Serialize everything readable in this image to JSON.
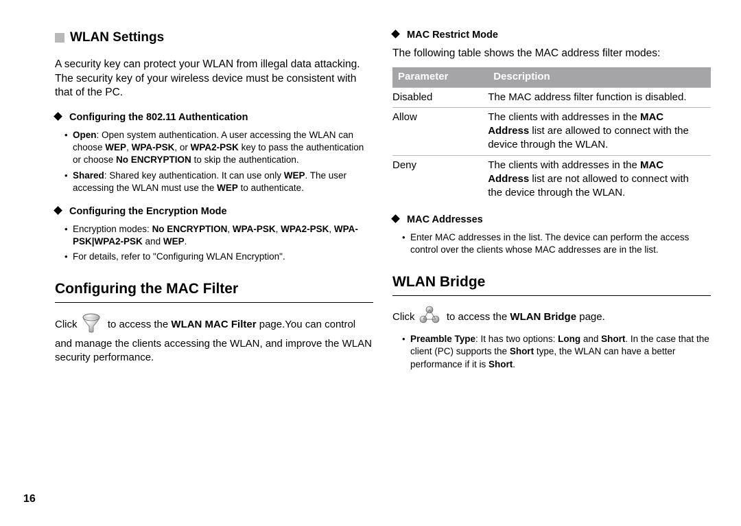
{
  "page_number": "16",
  "title": "WLAN Settings",
  "left": {
    "intro": "A security key can protect your WLAN from illegal data attacking. The security key of your wireless device must be consistent with that of the PC.",
    "s1_title": "Configuring the 802.11 Authentication",
    "s1_bullets": [
      {
        "lead": "Open",
        "rest": ": Open system authentication. A user accessing the WLAN can choose ",
        "b1": "WEP",
        "c1": ", ",
        "b2": "WPA-PSK",
        "c2": ", or ",
        "b3": "WPA2-PSK",
        "rest2": " key to pass the authentication or choose ",
        "b4": "No ENCRYPTION",
        "rest3": " to skip the authentication."
      },
      {
        "lead": "Shared",
        "rest": ": Shared key authentication. It can use only ",
        "b1": "WEP",
        "c1": ". The user accessing the WLAN must use the ",
        "b2": "WEP",
        "rest2": " to authenticate."
      }
    ],
    "s2_title": "Configuring the Encryption Mode",
    "s2_bullets": [
      {
        "pre": "Encryption modes: ",
        "b1": "No ENCRYPTION",
        "c1": ", ",
        "b2": "WPA-PSK",
        "c2": ", ",
        "b3": "WPA2-PSK",
        "c3": ", ",
        "b4": "WPA-PSK|WPA2-PSK",
        "c4": " and ",
        "b5": "WEP",
        "rest": "."
      },
      {
        "pre": "For details, refer to \"Configuring WLAN Encryption\"."
      }
    ],
    "h2": "Configuring the MAC Filter",
    "mac_intro_pre": "Click ",
    "mac_intro_mid": " to access the ",
    "mac_intro_bold": "WLAN MAC Filter",
    "mac_intro_post": " page.You can control and manage the clients accessing the WLAN, and improve the WLAN security performance."
  },
  "right": {
    "s1_title": "MAC Restrict Mode",
    "s1_intro": "The following table shows the MAC address filter modes:",
    "table": {
      "headers": {
        "p": "Parameter",
        "d": "Description"
      },
      "rows": [
        {
          "p": "Disabled",
          "d_pre": "The MAC address filter function is disabled."
        },
        {
          "p": "Allow",
          "d_pre": "The clients with addresses in the ",
          "d_b": "MAC Address",
          "d_post": " list are allowed to connect with the device through the WLAN."
        },
        {
          "p": "Deny",
          "d_pre": "The clients with addresses in the ",
          "d_b": "MAC Address",
          "d_post": " list are not allowed to connect with the device through the WLAN."
        }
      ]
    },
    "s2_title": "MAC Addresses",
    "s2_bullet": "Enter MAC addresses in the list. The device can perform the access control over the clients whose MAC addresses are in the list.",
    "h2": "WLAN Bridge",
    "bridge_pre": "Click ",
    "bridge_mid": " to access the ",
    "bridge_bold": "WLAN Bridge",
    "bridge_post": " page.",
    "preamble_lead": "Preamble Type",
    "preamble_rest": ": It has two options: ",
    "pL": "Long",
    "and": " and ",
    "pS": "Short",
    "preamble_tail": ". In the case that the client (PC) supports the ",
    "pS2": "Short",
    "tail2": " type, the WLAN can have a better performance if it is ",
    "pS3": "Short",
    "dot": "."
  }
}
